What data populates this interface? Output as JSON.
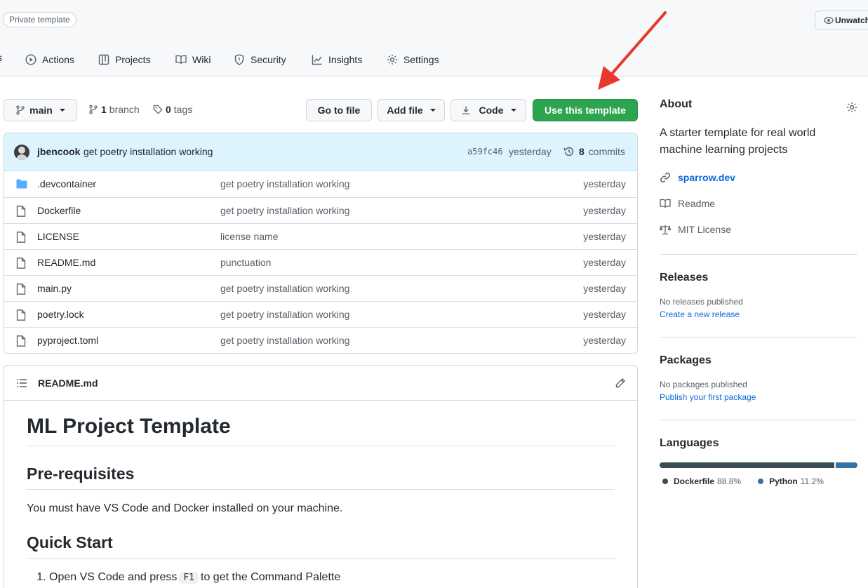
{
  "header": {
    "badge": "Private template",
    "unwatch": "Unwatch"
  },
  "nav": {
    "stub": "s",
    "items": [
      {
        "label": "Actions",
        "icon": "play-icon"
      },
      {
        "label": "Projects",
        "icon": "table-icon"
      },
      {
        "label": "Wiki",
        "icon": "book-icon"
      },
      {
        "label": "Security",
        "icon": "shield-icon"
      },
      {
        "label": "Insights",
        "icon": "graph-icon"
      },
      {
        "label": "Settings",
        "icon": "gear-icon"
      }
    ]
  },
  "toolbar": {
    "branch": "main",
    "branch_count": "1",
    "branch_word": "branch",
    "tag_count": "0",
    "tag_word": "tags",
    "go_to_file": "Go to file",
    "add_file": "Add file",
    "code": "Code",
    "use_template": "Use this template"
  },
  "commit": {
    "author": "jbencook",
    "message": "get poetry installation working",
    "sha": "a59fc46",
    "time": "yesterday",
    "count": "8",
    "count_word": "commits"
  },
  "files": [
    {
      "name": ".devcontainer",
      "type": "folder",
      "message": "get poetry installation working",
      "time": "yesterday"
    },
    {
      "name": "Dockerfile",
      "type": "file",
      "message": "get poetry installation working",
      "time": "yesterday"
    },
    {
      "name": "LICENSE",
      "type": "file",
      "message": "license name",
      "time": "yesterday"
    },
    {
      "name": "README.md",
      "type": "file",
      "message": "punctuation",
      "time": "yesterday"
    },
    {
      "name": "main.py",
      "type": "file",
      "message": "get poetry installation working",
      "time": "yesterday"
    },
    {
      "name": "poetry.lock",
      "type": "file",
      "message": "get poetry installation working",
      "time": "yesterday"
    },
    {
      "name": "pyproject.toml",
      "type": "file",
      "message": "get poetry installation working",
      "time": "yesterday"
    }
  ],
  "readme": {
    "filename": "README.md",
    "h1": "ML Project Template",
    "h2_prereq": "Pre-requisites",
    "prereq_text": "You must have VS Code and Docker installed on your machine.",
    "h2_quickstart": "Quick Start",
    "step1_before": "Open VS Code and press",
    "step1_key": "F1",
    "step1_after": "to get the Command Palette"
  },
  "about": {
    "title": "About",
    "description": "A starter template for real world machine learning projects",
    "website": "sparrow.dev",
    "readme": "Readme",
    "license": "MIT License"
  },
  "releases": {
    "title": "Releases",
    "empty": "No releases published",
    "link": "Create a new release"
  },
  "packages": {
    "title": "Packages",
    "empty": "No packages published",
    "link": "Publish your first package"
  },
  "languages": {
    "title": "Languages",
    "items": [
      {
        "name": "Dockerfile",
        "percent": "88.8%",
        "value": 88.8,
        "color": "#384d54"
      },
      {
        "name": "Python",
        "percent": "11.2%",
        "value": 11.2,
        "color": "#3572a5"
      }
    ]
  },
  "colors": {
    "accent_green": "#2da44e",
    "link_blue": "#0969da",
    "arrow_red": "#e8372c"
  }
}
